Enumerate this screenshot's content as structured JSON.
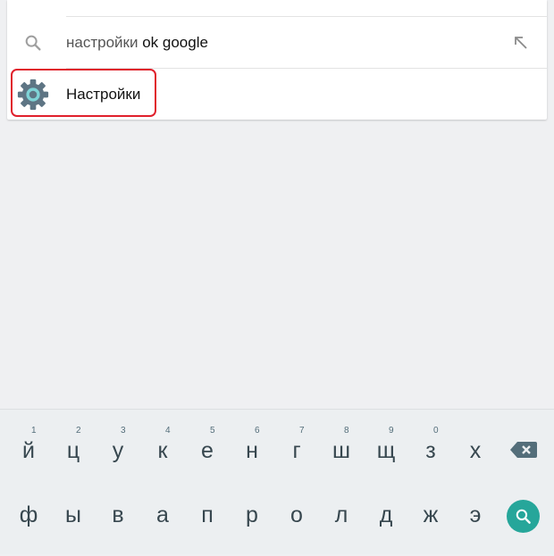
{
  "search": {
    "query_prefix": "настройки ",
    "query_suffix": "ok google"
  },
  "result": {
    "label": "Настройки",
    "icon": "settings-gear-icon"
  },
  "keyboard": {
    "row1": [
      {
        "key": "й",
        "hint": "1"
      },
      {
        "key": "ц",
        "hint": "2"
      },
      {
        "key": "у",
        "hint": "3"
      },
      {
        "key": "к",
        "hint": "4"
      },
      {
        "key": "е",
        "hint": "5"
      },
      {
        "key": "н",
        "hint": "6"
      },
      {
        "key": "г",
        "hint": "7"
      },
      {
        "key": "ш",
        "hint": "8"
      },
      {
        "key": "щ",
        "hint": "9"
      },
      {
        "key": "з",
        "hint": "0"
      },
      {
        "key": "х",
        "hint": ""
      }
    ],
    "row2": [
      "ф",
      "ы",
      "в",
      "а",
      "п",
      "р",
      "о",
      "л",
      "д",
      "ж",
      "э"
    ],
    "backspace_icon": "backspace-icon",
    "search_icon": "search-icon"
  },
  "colors": {
    "accent": "#26a69a",
    "highlight": "#e0202c",
    "background": "#eff0f2"
  }
}
